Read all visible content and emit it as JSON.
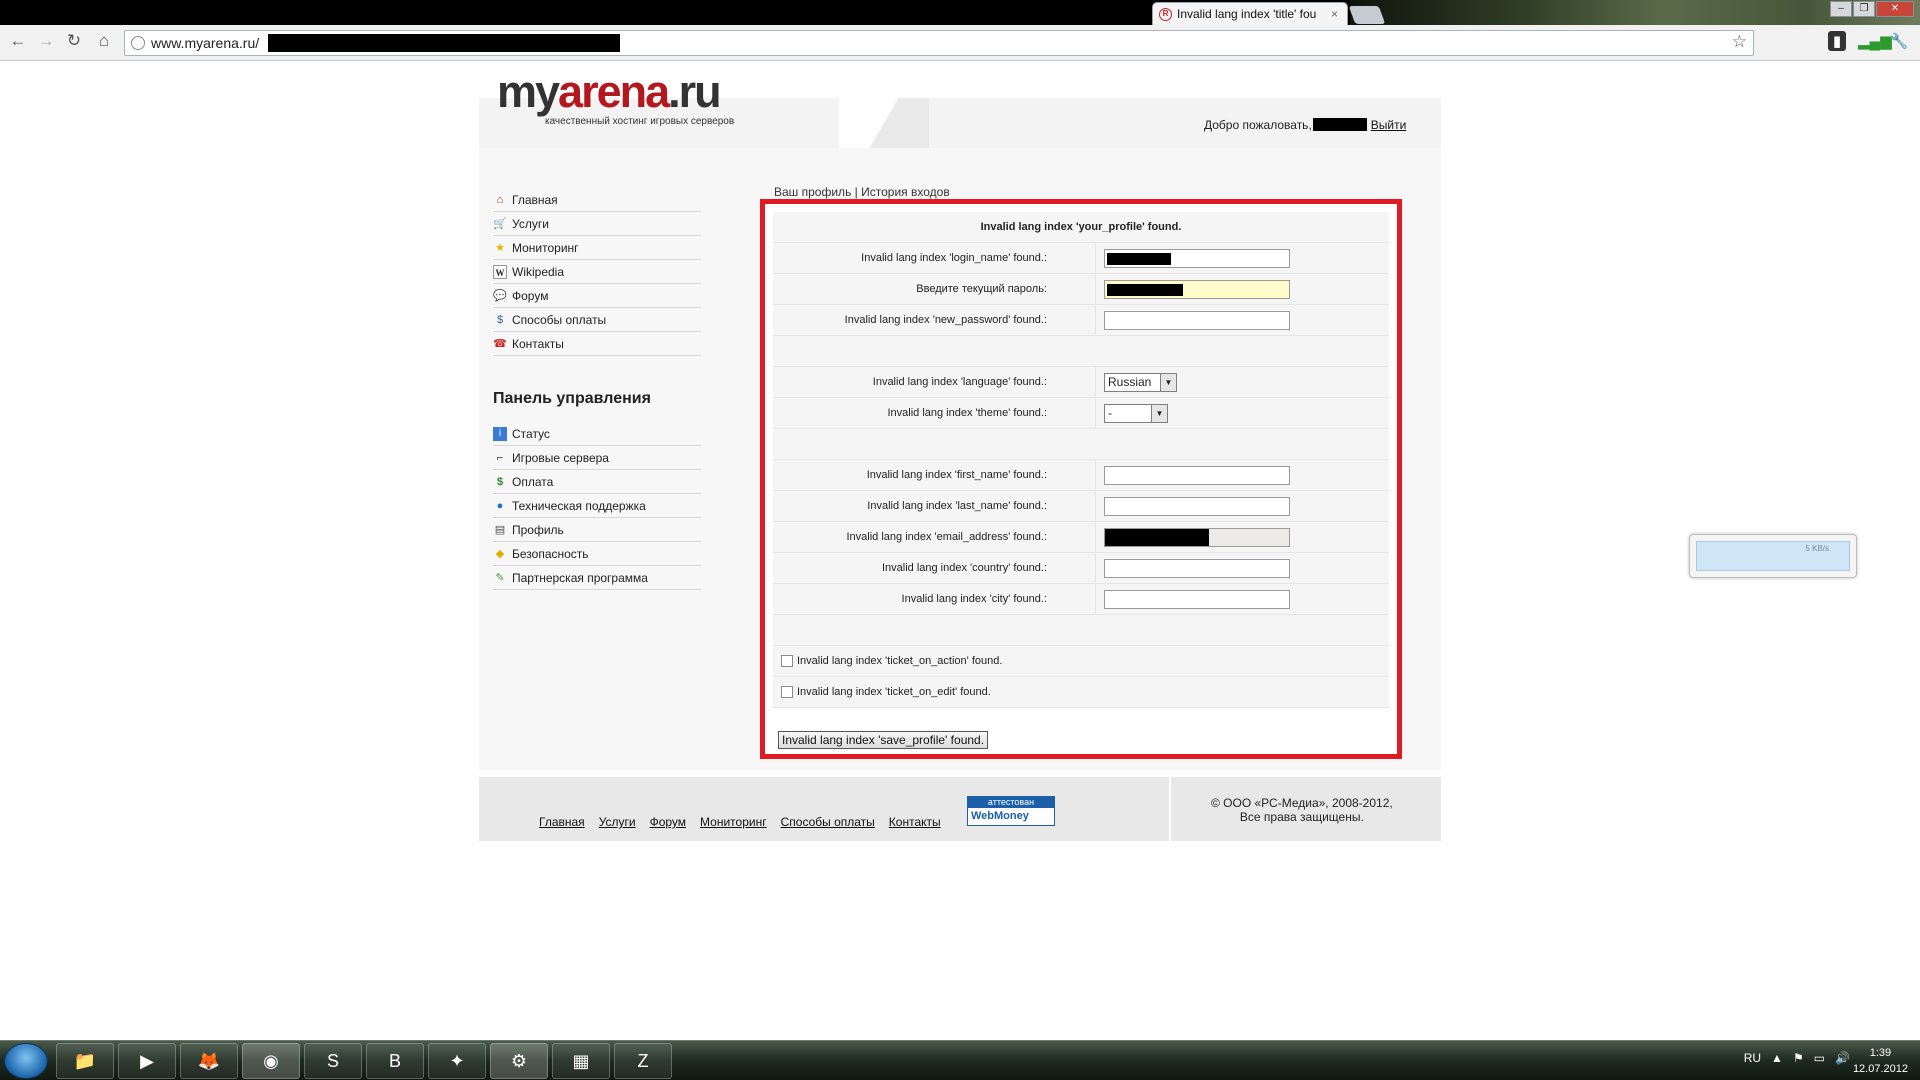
{
  "browser": {
    "tab_title": "Invalid lang index 'title' fou",
    "tab_close": "×",
    "url": "www.myarena.ru/",
    "window_buttons": [
      "–",
      "❐",
      "✕"
    ]
  },
  "site": {
    "logo_my": "my",
    "logo_arena": "arena",
    "logo_ru": ".ru",
    "tagline": "качественный хостинг игровых серверов",
    "welcome_text": "Добро пожаловать,",
    "logout": "Выйти"
  },
  "menu": [
    {
      "label": "Главная",
      "icon": "home-icon"
    },
    {
      "label": "Услуги",
      "icon": "cart-icon"
    },
    {
      "label": "Мониторинг",
      "icon": "star-icon"
    },
    {
      "label": "Wikipedia",
      "icon": "wikipedia-icon"
    },
    {
      "label": "Форум",
      "icon": "forum-icon"
    },
    {
      "label": "Способы оплаты",
      "icon": "payment-icon"
    },
    {
      "label": "Контакты",
      "icon": "phone-icon"
    }
  ],
  "panel": {
    "title": "Панель управления",
    "items": [
      {
        "label": "Статус",
        "icon": "info-icon"
      },
      {
        "label": "Игровые сервера",
        "icon": "gun-icon"
      },
      {
        "label": "Оплата",
        "icon": "money-icon"
      },
      {
        "label": "Техническая поддержка",
        "icon": "support-icon"
      },
      {
        "label": "Профиль",
        "icon": "profile-icon"
      },
      {
        "label": "Безопасность",
        "icon": "shield-icon"
      },
      {
        "label": "Партнерская программа",
        "icon": "partner-icon"
      }
    ]
  },
  "breadcrumbs": {
    "profile": "Ваш профиль",
    "separator": "|",
    "history": "История входов"
  },
  "form": {
    "heading": "Invalid lang index 'your_profile' found.",
    "login_label": "Invalid lang index 'login_name' found.:",
    "current_password_label": "Введите текущий пароль:",
    "new_password_label": "Invalid lang index 'new_password' found.:",
    "language_label": "Invalid lang index 'language' found.:",
    "language_value": "Russian",
    "theme_label": "Invalid lang index 'theme' found.:",
    "theme_value": "-",
    "first_name_label": "Invalid lang index 'first_name' found.:",
    "last_name_label": "Invalid lang index 'last_name' found.:",
    "email_label": "Invalid lang index 'email_address' found.:",
    "country_label": "Invalid lang index 'country' found.:",
    "city_label": "Invalid lang index 'city' found.:",
    "ticket_on_action": "Invalid lang index 'ticket_on_action' found.",
    "ticket_on_edit": "Invalid lang index 'ticket_on_edit' found.",
    "save_button": "Invalid lang index 'save_profile' found."
  },
  "footer": {
    "links": [
      "Главная",
      "Услуги",
      "Форум",
      "Мониторинг",
      "Способы оплаты",
      "Контакты"
    ],
    "webmoney_top": "аттестован",
    "webmoney_bottom": "WebMoney",
    "copyright_line1": "© ООО «РС-Медиа», 2008-2012,",
    "copyright_line2": "Все права защищены."
  },
  "widget": {
    "rate": "5 KB/s"
  },
  "taskbar": {
    "language": "RU",
    "time": "1:39",
    "date": "12.07.2012"
  },
  "colors": {
    "highlight_border": "#e11b24",
    "logo_red": "#b3181f"
  }
}
